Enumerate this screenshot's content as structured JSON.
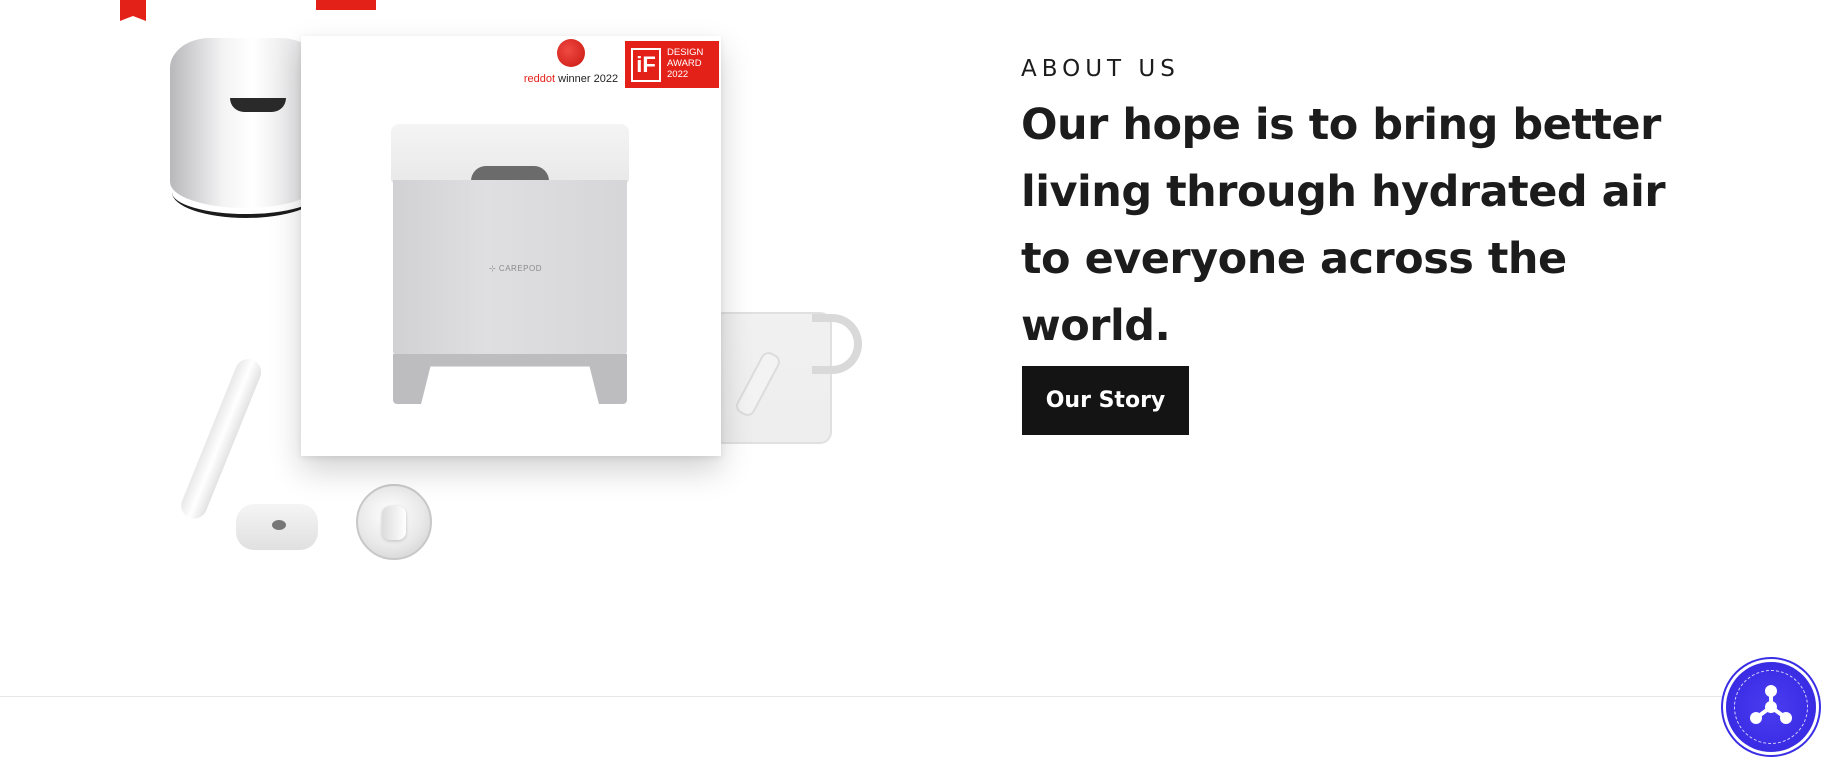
{
  "media": {
    "award_reddot_brand": "reddot",
    "award_reddot_label": " winner 2022",
    "award_if_mark": "iF",
    "award_if_line1": "DESIGN",
    "award_if_line2": "AWARD",
    "award_if_line3": "2022",
    "product_logo": "⊹ CAREPOD"
  },
  "about": {
    "eyebrow": "ABOUT US",
    "headline": "Our hope is to bring better living through hydrated air to everyone across the world.",
    "cta_label": "Our Story"
  },
  "colors": {
    "accent": "#141414",
    "award_red": "#e32119",
    "badge_blue": "#3b2ee6"
  },
  "icons": {
    "floating_badge": "carepod-logo-icon"
  }
}
